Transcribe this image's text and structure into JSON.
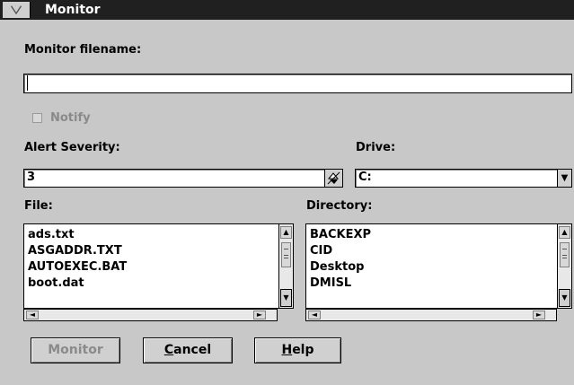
{
  "window": {
    "title": "Monitor"
  },
  "labels": {
    "monitor_filename": "Monitor filename:",
    "notify": "Notify",
    "alert_severity": "Alert Severity:",
    "drive": "Drive:",
    "file": "File:",
    "directory": "Directory:"
  },
  "fields": {
    "monitor_filename": "",
    "alert_severity": "3",
    "drive": "C:"
  },
  "files": [
    "ads.txt",
    "ASGADDR.TXT",
    "AUTOEXEC.BAT",
    "boot.dat"
  ],
  "directories": [
    "BACKEXP",
    "CID",
    "Desktop",
    "DMISL"
  ],
  "buttons": {
    "monitor": "Monitor",
    "cancel_rest": "ancel",
    "cancel_mnemonic": "C",
    "help_rest": "elp",
    "help_mnemonic": "H"
  },
  "icons": {
    "system_menu": "system-menu-icon",
    "spin": "spin-arrows-icon",
    "dropdown": "dropdown-arrow-icon"
  }
}
